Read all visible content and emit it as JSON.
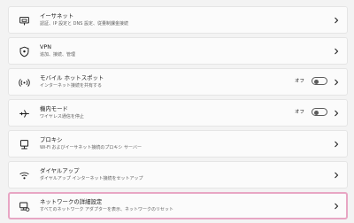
{
  "settings": [
    {
      "title": "イーサネット",
      "desc": "認証、IP 設定と DNS 設定、従量制課金接続",
      "icon": "ethernet-icon"
    },
    {
      "title": "VPN",
      "desc": "追加、接続、管理",
      "icon": "vpn-shield-icon"
    },
    {
      "title": "モバイル ホットスポット",
      "desc": "インターネット接続を共有する",
      "icon": "hotspot-icon",
      "state": "オフ",
      "toggle_on": false
    },
    {
      "title": "機内モード",
      "desc": "ワイヤレス通信を停止",
      "icon": "airplane-icon",
      "state": "オフ",
      "toggle_on": false
    },
    {
      "title": "プロキシ",
      "desc": "Wi-Fi およびイーサネット接続のプロキシ サーバー",
      "icon": "proxy-icon"
    },
    {
      "title": "ダイヤルアップ",
      "desc": "ダイヤルアップ インターネット接続をセットアップ",
      "icon": "dialup-icon"
    },
    {
      "title": "ネットワークの詳細設定",
      "desc": "すべてのネットワーク アダプターを表示、ネットワークのリセット",
      "icon": "advanced-network-icon"
    }
  ],
  "colors": {
    "highlight_border": "#e8a6c4",
    "card_bg": "#fbfbfb",
    "page_bg": "#f3f3f3"
  }
}
